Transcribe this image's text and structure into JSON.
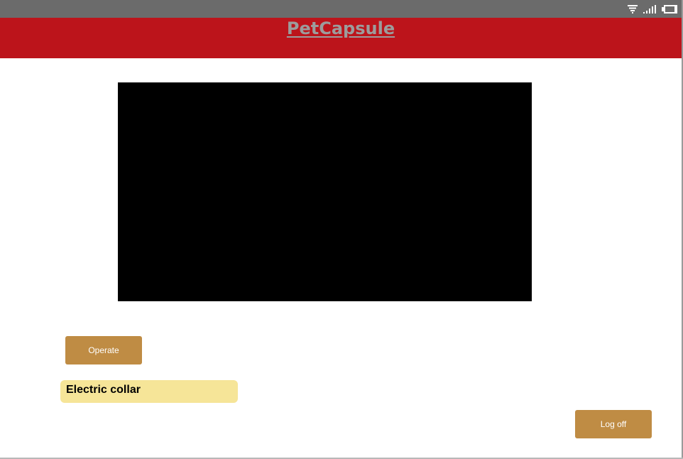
{
  "status_bar": {
    "icons": [
      "wifi-icon",
      "signal-icon",
      "battery-icon"
    ]
  },
  "header": {
    "title": "PetCapsule"
  },
  "video": {
    "content": ""
  },
  "controls": {
    "operate_label": "Operate",
    "collar_label": "Electric collar",
    "logoff_label": "Log off"
  },
  "colors": {
    "status_bar": "#6b6b6b",
    "header": "#bc141b",
    "title": "#9c9c9c",
    "button": "#bf8c44",
    "label_bg": "#f6e598",
    "video": "#000000"
  }
}
